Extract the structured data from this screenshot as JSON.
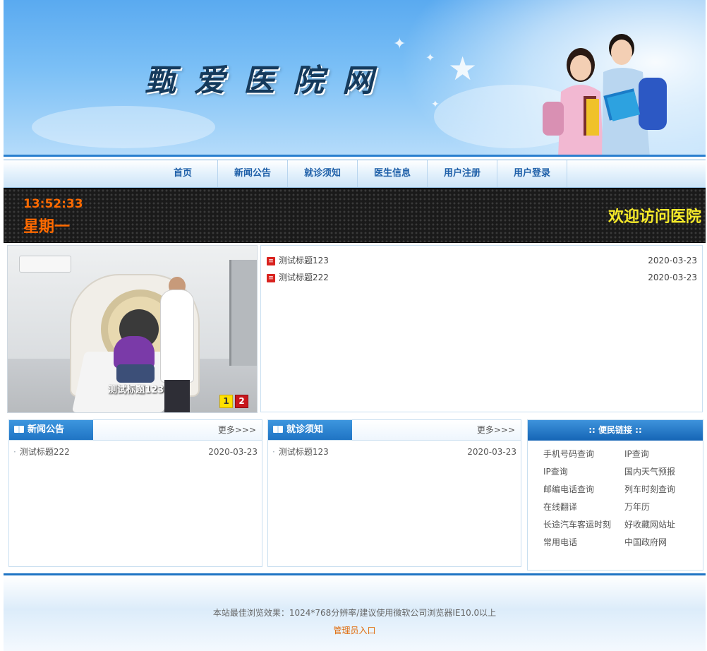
{
  "banner": {
    "title": "甄爱医院网"
  },
  "nav": {
    "items": [
      "首页",
      "新闻公告",
      "就诊须知",
      "医生信息",
      "用户注册",
      "用户登录"
    ]
  },
  "led": {
    "time": "13:52:33",
    "weekday": "星期一",
    "message": "欢迎访问医院"
  },
  "slideshow": {
    "caption": "测试标题123",
    "pages": [
      "1",
      "2"
    ]
  },
  "top_news": [
    {
      "title": "测试标题123",
      "date": "2020-03-23"
    },
    {
      "title": "测试标题222",
      "date": "2020-03-23"
    }
  ],
  "news_panel": {
    "title": "新闻公告",
    "more": "更多>>>",
    "items": [
      {
        "title": "测试标题222",
        "date": "2020-03-23"
      }
    ]
  },
  "notice_panel": {
    "title": "就诊须知",
    "more": "更多>>>",
    "items": [
      {
        "title": "测试标题123",
        "date": "2020-03-23"
      }
    ]
  },
  "links_panel": {
    "title": ":: 便民链接 ::",
    "items": [
      "手机号码查询",
      "IP查询",
      "IP查询",
      "国内天气预报",
      "邮编电话查询",
      "列车时刻查询",
      "在线翻译",
      "万年历",
      "长途汽车客运时刻",
      "好收藏网站址",
      "常用电话",
      "中国政府网"
    ]
  },
  "footer": {
    "text": "本站最佳浏览效果：1024*768分辨率/建议使用微软公司浏览器IE10.0以上",
    "admin_link": "管理员入口"
  },
  "colors": {
    "accent": "#1f74c4",
    "led_orange": "#ff6a00",
    "led_yellow": "#f6ea2a",
    "admin_link": "#e06e10"
  }
}
